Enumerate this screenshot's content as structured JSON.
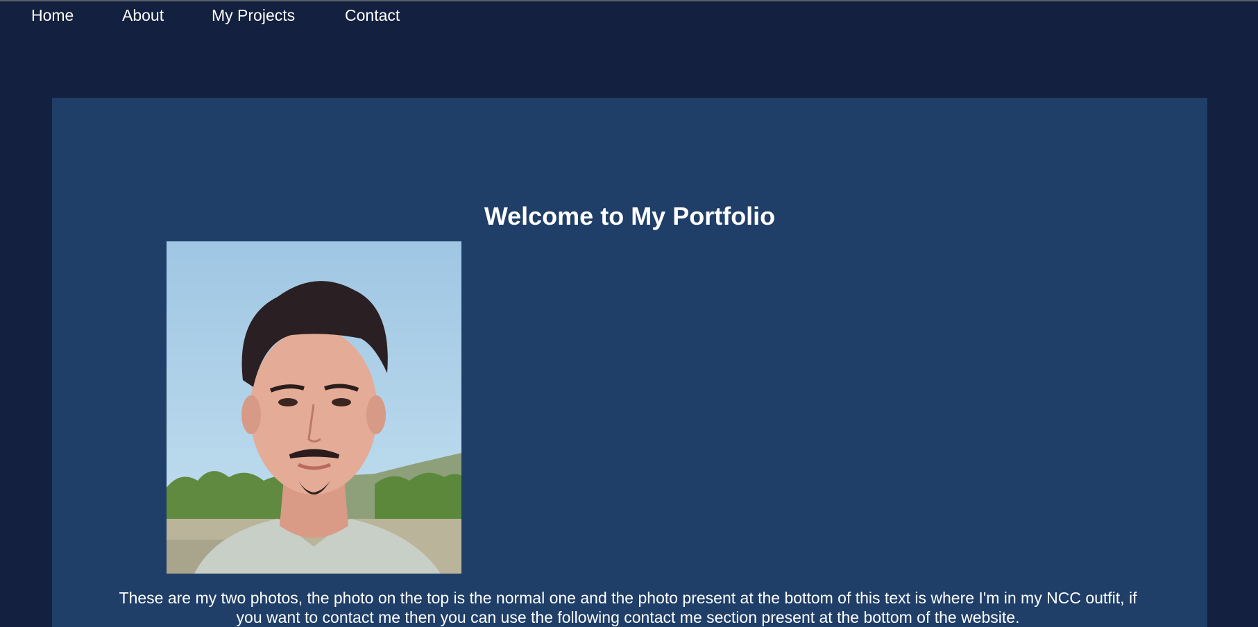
{
  "nav": {
    "items": [
      {
        "label": "Home"
      },
      {
        "label": "About"
      },
      {
        "label": "My Projects"
      },
      {
        "label": "Contact"
      }
    ]
  },
  "main": {
    "title": "Welcome to My Portfolio",
    "caption": "These are my two photos, the photo on the top is the normal one and the photo present at the bottom of this text is where I'm in my NCC outfit, if you want to contact me then you can use the following contact me section present at the bottom of the website."
  },
  "colors": {
    "page_background": "#13203f",
    "panel_background": "#1f3e68",
    "text": "#ffffff"
  }
}
